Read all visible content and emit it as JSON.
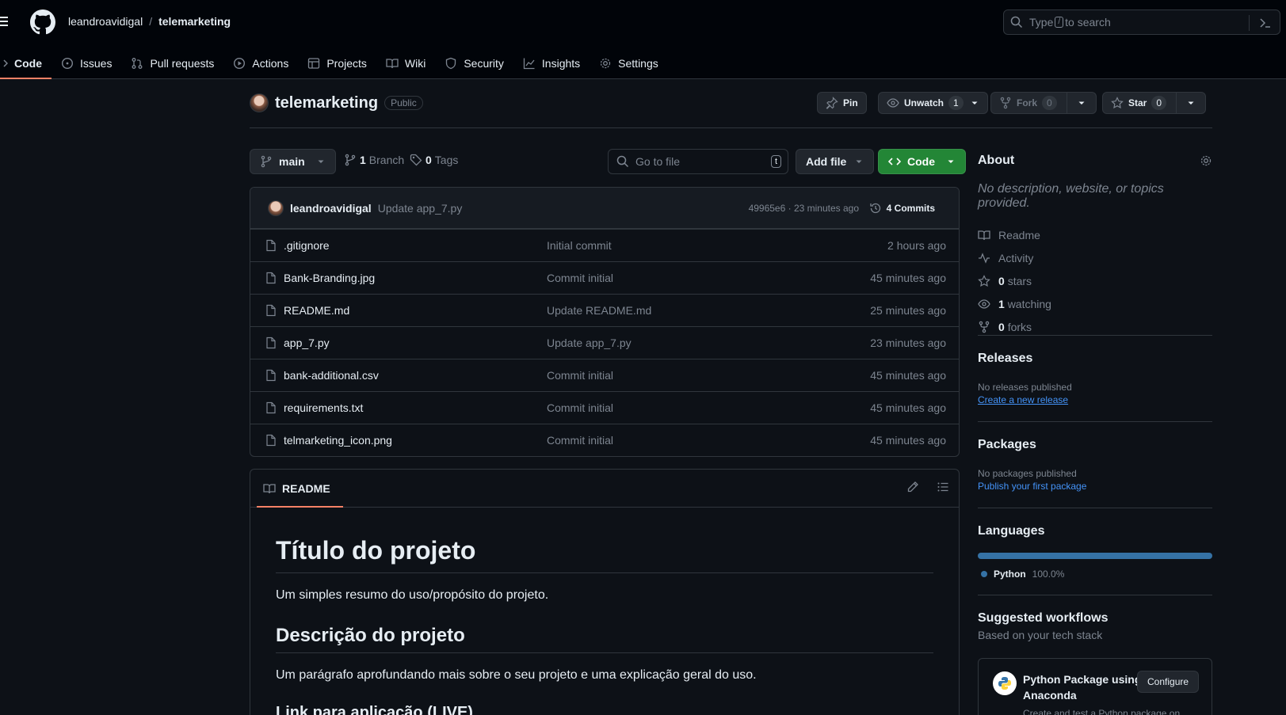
{
  "header": {
    "owner": "leandroavidigal",
    "separator": "/",
    "repo": "telemarketing",
    "search_pre": "Type",
    "search_key": "/",
    "search_post": "to search"
  },
  "nav": {
    "tabs": [
      {
        "label": "Code",
        "icon": "code-icon"
      },
      {
        "label": "Issues",
        "icon": "issue-icon"
      },
      {
        "label": "Pull requests",
        "icon": "pull-request-icon"
      },
      {
        "label": "Actions",
        "icon": "play-icon"
      },
      {
        "label": "Projects",
        "icon": "table-icon"
      },
      {
        "label": "Wiki",
        "icon": "book-icon"
      },
      {
        "label": "Security",
        "icon": "shield-icon"
      },
      {
        "label": "Insights",
        "icon": "graph-icon"
      },
      {
        "label": "Settings",
        "icon": "gear-icon"
      }
    ]
  },
  "repo": {
    "name": "telemarketing",
    "visibility": "Public",
    "pin_label": "Pin",
    "watch_label": "Unwatch",
    "watch_count": "1",
    "fork_label": "Fork",
    "fork_count": "0",
    "star_label": "Star",
    "star_count": "0"
  },
  "browser": {
    "branch": "main",
    "branch_count": "1",
    "branch_word": "Branch",
    "tag_count": "0",
    "tag_word": "Tags",
    "goto_placeholder": "Go to file",
    "goto_key": "t",
    "add_file": "Add file",
    "code_btn": "Code"
  },
  "commit": {
    "author": "leandroavidigal",
    "message": "Update app_7.py",
    "sha_time": "49965e6 · 23 minutes ago",
    "commits": "4 Commits"
  },
  "files": [
    {
      "name": ".gitignore",
      "msg": "Initial commit",
      "date": "2 hours ago"
    },
    {
      "name": "Bank-Branding.jpg",
      "msg": "Commit initial",
      "date": "45 minutes ago"
    },
    {
      "name": "README.md",
      "msg": "Update README.md",
      "date": "25 minutes ago"
    },
    {
      "name": "app_7.py",
      "msg": "Update app_7.py",
      "date": "23 minutes ago"
    },
    {
      "name": "bank-additional.csv",
      "msg": "Commit initial",
      "date": "45 minutes ago"
    },
    {
      "name": "requirements.txt",
      "msg": "Commit initial",
      "date": "45 minutes ago"
    },
    {
      "name": "telmarketing_icon.png",
      "msg": "Commit initial",
      "date": "45 minutes ago"
    }
  ],
  "readme": {
    "tab": "README",
    "h1": "Título do projeto",
    "p1": "Um simples resumo do uso/propósito do projeto.",
    "h2": "Descrição do projeto",
    "p2": "Um parágrafo aprofundando mais sobre o seu projeto e uma explicação geral do uso.",
    "h3": "Link para aplicação (LIVE)"
  },
  "sidebar": {
    "about_title": "About",
    "about_desc": "No description, website, or topics provided.",
    "readme": "Readme",
    "activity": "Activity",
    "stars_count": "0",
    "stars_word": "stars",
    "watching_count": "1",
    "watching_word": "watching",
    "forks_count": "0",
    "forks_word": "forks",
    "releases_title": "Releases",
    "releases_none": "No releases published",
    "releases_link": "Create a new release",
    "packages_title": "Packages",
    "packages_none": "No packages published",
    "packages_link": "Publish your first package",
    "languages_title": "Languages",
    "language_name": "Python",
    "language_pct": "100.0%",
    "language_pct_value": 100.0,
    "language_color": "#3572a5",
    "suggested_title": "Suggested workflows",
    "suggested_sub": "Based on your tech stack",
    "workflow_title": "Python Package using Anaconda",
    "workflow_btn": "Configure",
    "workflow_desc": "Create and test a Python package on"
  },
  "colors": {
    "accent_tab": "#f78166",
    "code_button": "#238636",
    "link": "#4493f8"
  }
}
